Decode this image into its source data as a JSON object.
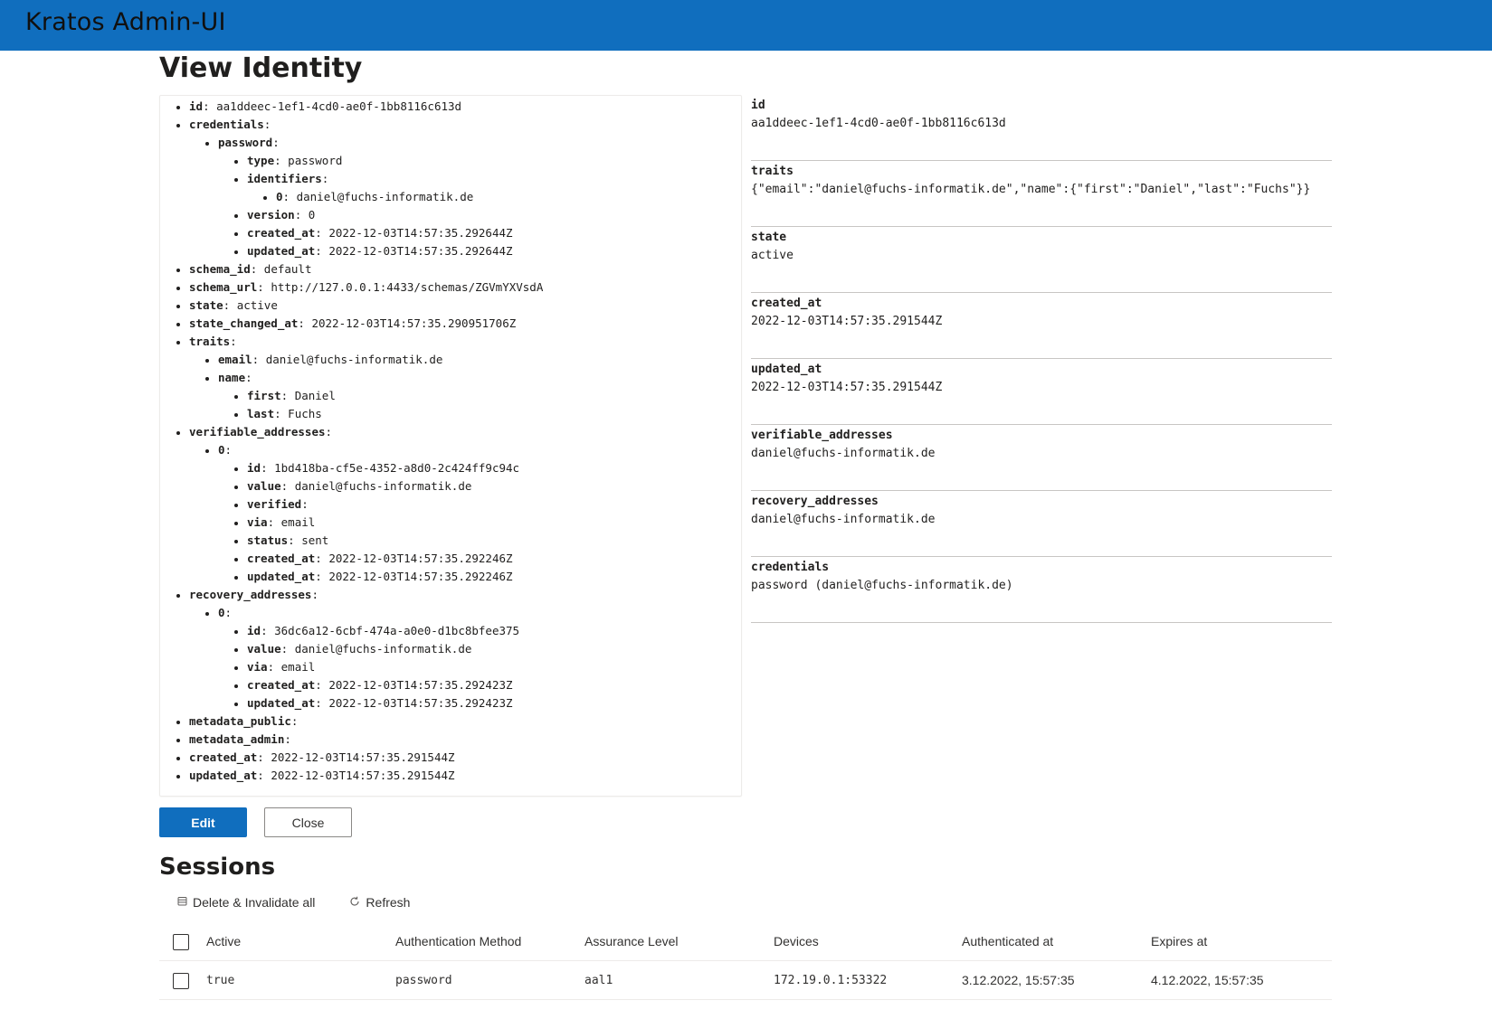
{
  "header": {
    "app_title": "Kratos Admin-UI"
  },
  "page": {
    "title": "View Identity"
  },
  "tree": {
    "id": {
      "key": "id",
      "value": "aa1ddeec-1ef1-4cd0-ae0f-1bb8116c613d"
    },
    "credentials": {
      "key": "credentials",
      "password": {
        "key": "password",
        "type": {
          "key": "type",
          "value": "password"
        },
        "identifiers": {
          "key": "identifiers",
          "item0": {
            "key": "0",
            "value": "daniel@fuchs-informatik.de"
          }
        },
        "version": {
          "key": "version",
          "value": "0"
        },
        "created_at": {
          "key": "created_at",
          "value": "2022-12-03T14:57:35.292644Z"
        },
        "updated_at": {
          "key": "updated_at",
          "value": "2022-12-03T14:57:35.292644Z"
        }
      }
    },
    "schema_id": {
      "key": "schema_id",
      "value": "default"
    },
    "schema_url": {
      "key": "schema_url",
      "value": "http://127.0.0.1:4433/schemas/ZGVmYXVsdA"
    },
    "state": {
      "key": "state",
      "value": "active"
    },
    "state_changed_at": {
      "key": "state_changed_at",
      "value": "2022-12-03T14:57:35.290951706Z"
    },
    "traits": {
      "key": "traits",
      "email": {
        "key": "email",
        "value": "daniel@fuchs-informatik.de"
      },
      "name": {
        "key": "name",
        "first": {
          "key": "first",
          "value": "Daniel"
        },
        "last": {
          "key": "last",
          "value": "Fuchs"
        }
      }
    },
    "verifiable_addresses": {
      "key": "verifiable_addresses",
      "item0": {
        "key": "0",
        "id": {
          "key": "id",
          "value": "1bd418ba-cf5e-4352-a8d0-2c424ff9c94c"
        },
        "value": {
          "key": "value",
          "value": "daniel@fuchs-informatik.de"
        },
        "verified": {
          "key": "verified",
          "value": ""
        },
        "via": {
          "key": "via",
          "value": "email"
        },
        "status": {
          "key": "status",
          "value": "sent"
        },
        "created_at": {
          "key": "created_at",
          "value": "2022-12-03T14:57:35.292246Z"
        },
        "updated_at": {
          "key": "updated_at",
          "value": "2022-12-03T14:57:35.292246Z"
        }
      }
    },
    "recovery_addresses": {
      "key": "recovery_addresses",
      "item0": {
        "key": "0",
        "id": {
          "key": "id",
          "value": "36dc6a12-6cbf-474a-a0e0-d1bc8bfee375"
        },
        "value": {
          "key": "value",
          "value": "daniel@fuchs-informatik.de"
        },
        "via": {
          "key": "via",
          "value": "email"
        },
        "created_at": {
          "key": "created_at",
          "value": "2022-12-03T14:57:35.292423Z"
        },
        "updated_at": {
          "key": "updated_at",
          "value": "2022-12-03T14:57:35.292423Z"
        }
      }
    },
    "metadata_public": {
      "key": "metadata_public",
      "value": ""
    },
    "metadata_admin": {
      "key": "metadata_admin",
      "value": ""
    },
    "created_at": {
      "key": "created_at",
      "value": "2022-12-03T14:57:35.291544Z"
    },
    "updated_at": {
      "key": "updated_at",
      "value": "2022-12-03T14:57:35.291544Z"
    }
  },
  "details": [
    {
      "label": "id",
      "value": "aa1ddeec-1ef1-4cd0-ae0f-1bb8116c613d"
    },
    {
      "label": "traits",
      "value": "{\"email\":\"daniel@fuchs-informatik.de\",\"name\":{\"first\":\"Daniel\",\"last\":\"Fuchs\"}}"
    },
    {
      "label": "state",
      "value": "active"
    },
    {
      "label": "created_at",
      "value": "2022-12-03T14:57:35.291544Z"
    },
    {
      "label": "updated_at",
      "value": "2022-12-03T14:57:35.291544Z"
    },
    {
      "label": "verifiable_addresses",
      "value": "daniel@fuchs-informatik.de"
    },
    {
      "label": "recovery_addresses",
      "value": "daniel@fuchs-informatik.de"
    },
    {
      "label": "credentials",
      "value": "password (daniel@fuchs-informatik.de)"
    }
  ],
  "buttons": {
    "edit": "Edit",
    "close": "Close"
  },
  "sessions": {
    "title": "Sessions",
    "commands": {
      "delete_all": "Delete & Invalidate all",
      "refresh": "Refresh"
    },
    "icons": {
      "delete": "delete-icon",
      "refresh": "refresh-icon"
    },
    "columns": [
      "Active",
      "Authentication Method",
      "Assurance Level",
      "Devices",
      "Authenticated at",
      "Expires at"
    ],
    "rows": [
      {
        "active": "true",
        "method": "password",
        "level": "aal1",
        "devices": "172.19.0.1:53322",
        "authenticated_at": "3.12.2022, 15:57:35",
        "expires_at": "4.12.2022, 15:57:35"
      }
    ]
  },
  "colors": {
    "header_bg": "#106ebe",
    "primary_button": "#106ebe",
    "divider": "#c8c6c4"
  }
}
